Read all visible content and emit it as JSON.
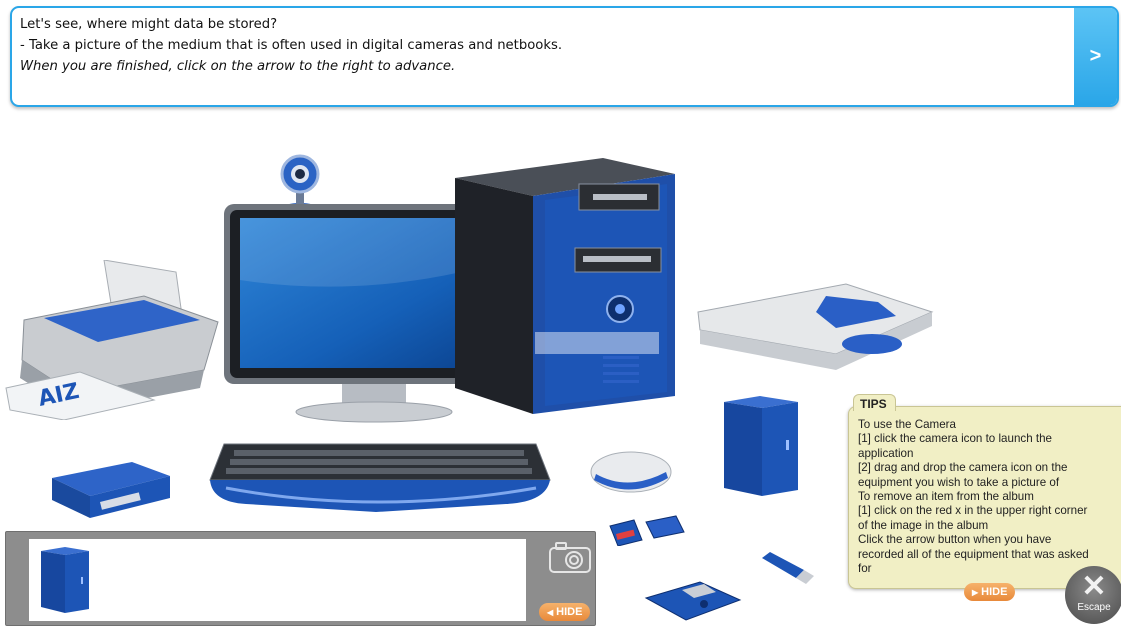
{
  "banner": {
    "line1": "Let's see, where might data be stored?",
    "line2": "- Take a picture of the medium that is often used in digital cameras and netbooks.",
    "line3": "When you are finished, click on the arrow to the right to advance.",
    "next_label": ">"
  },
  "tips": {
    "title": "TIPS",
    "lines": [
      "To use the Camera",
      "[1] click the camera icon to launch the",
      "application",
      "[2] drag and drop the camera icon on the",
      "equipment you wish to take a picture of",
      "To remove an item from the album",
      "[1] click on the red x in the upper right corner",
      "of the image in the album",
      "Click the arrow  button when you have",
      "recorded all of the equipment that was asked",
      "for"
    ],
    "hide_label": "HIDE"
  },
  "album": {
    "hide_label": "HIDE"
  },
  "escape": {
    "label": "Escape"
  },
  "colors": {
    "accent": "#2aa6e8",
    "equipment_blue": "#1d55b6",
    "tips_bg": "#f1efc5",
    "hide_orange": "#e8893a"
  }
}
